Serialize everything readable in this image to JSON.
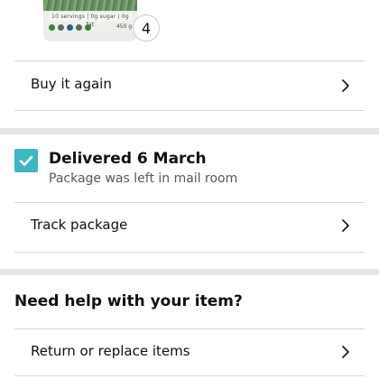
{
  "product": {
    "quantity": "4",
    "label_text": "10 servings | 0g sugar | 0g fat",
    "weight_text": "450 g"
  },
  "buy_again": {
    "label": "Buy it again"
  },
  "delivery": {
    "title": "Delivered 6 March",
    "subtitle": "Package was left in mail room",
    "status_color": "#3fb6c2"
  },
  "track": {
    "label": "Track package"
  },
  "help": {
    "heading": "Need help with your item?",
    "return_label": "Return or replace items"
  },
  "icons": {
    "chevron": "chevron-right-icon",
    "check": "check-icon"
  }
}
